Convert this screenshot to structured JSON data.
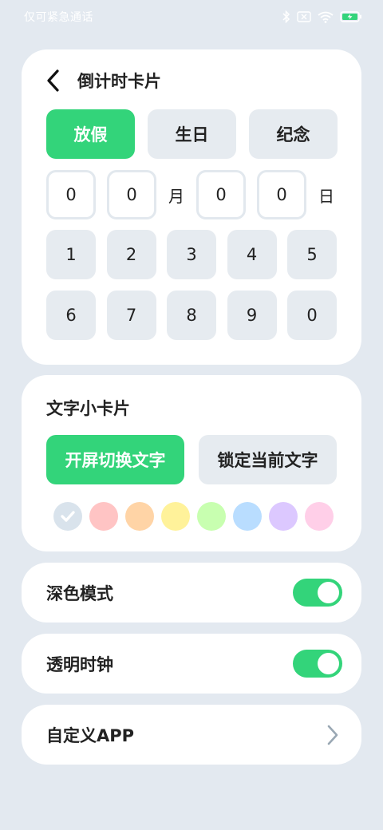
{
  "status_bar": {
    "carrier_text": "仅可紧急通话",
    "icons": [
      "bluetooth-icon",
      "no-sim-icon",
      "wifi-icon",
      "battery-charging-icon"
    ]
  },
  "countdown": {
    "title": "倒计时卡片",
    "back_icon": "back-arrow-icon",
    "categories": [
      {
        "label": "放假",
        "active": true
      },
      {
        "label": "生日",
        "active": false
      },
      {
        "label": "纪念",
        "active": false
      }
    ],
    "date": {
      "month_digits": [
        "0",
        "0"
      ],
      "month_unit": "月",
      "day_digits": [
        "0",
        "0"
      ],
      "day_unit": "日"
    },
    "keypad": [
      "1",
      "2",
      "3",
      "4",
      "5",
      "6",
      "7",
      "8",
      "9",
      "0"
    ]
  },
  "text_card": {
    "title": "文字小卡片",
    "switch_label": "开屏切换文字",
    "lock_label": "锁定当前文字",
    "swatches": [
      "#d9e3ec",
      "#ffc4c4",
      "#ffd4a6",
      "#fff29a",
      "#c8ffb0",
      "#b9ddff",
      "#dcc8ff",
      "#ffcfe8"
    ],
    "selected_swatch_index": 0,
    "check_color": "#ffffff"
  },
  "settings": {
    "dark_mode": {
      "label": "深色模式",
      "on": true
    },
    "transparent_clock": {
      "label": "透明时钟",
      "on": true
    },
    "custom_app": {
      "label": "自定义APP",
      "icon": "chevron-right-icon"
    }
  },
  "colors": {
    "accent": "#33d47a",
    "background": "#e3e9f0",
    "card": "#ffffff",
    "button_bg": "#e6ebf0"
  }
}
